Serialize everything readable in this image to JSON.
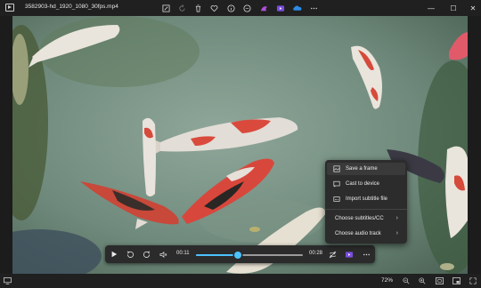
{
  "titlebar": {
    "filename": "3582903-hd_1920_1080_30fps.mp4",
    "toolbar_icons": [
      "edit-icon",
      "rotate-icon",
      "delete-icon",
      "favorite-icon",
      "info-icon",
      "more-apps-icon",
      "clipchamp-icon",
      "video-editor-icon",
      "onedrive-icon",
      "more-icon"
    ],
    "window_controls": {
      "minimize": "—",
      "maximize": "☐",
      "close": "✕"
    }
  },
  "player": {
    "current_time": "00:11",
    "total_time": "00:28",
    "progress": 0.39,
    "accent_color": "#4cc2ff"
  },
  "context_menu": {
    "items": [
      {
        "label": "Save a frame",
        "icon": "save-frame-icon"
      },
      {
        "label": "Cast to device",
        "icon": "cast-icon"
      },
      {
        "label": "Import subtitle file",
        "icon": "subtitle-file-icon"
      },
      {
        "label": "Choose subtitles/CC",
        "submenu": true
      },
      {
        "label": "Choose audio track",
        "submenu": true
      }
    ]
  },
  "statusbar": {
    "zoom": "72%"
  }
}
